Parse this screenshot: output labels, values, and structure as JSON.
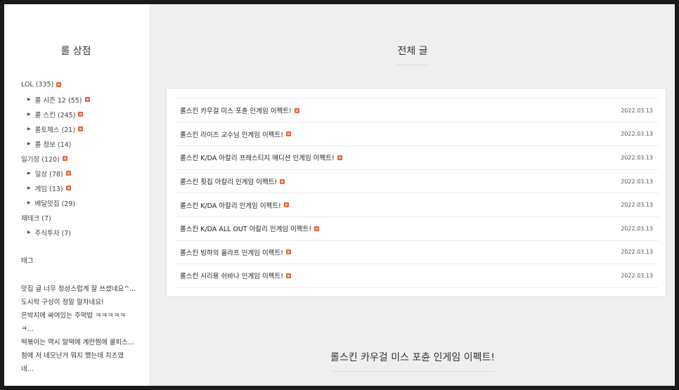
{
  "sidebar": {
    "title": "롤 상점",
    "categories": [
      {
        "label": "LOL (335)",
        "sub": false,
        "new": true
      },
      {
        "label": "롤 시즌 12 (55)",
        "sub": true,
        "new": true
      },
      {
        "label": "롤 스킨 (245)",
        "sub": true,
        "new": true
      },
      {
        "label": "롤토체스 (21)",
        "sub": true,
        "new": true
      },
      {
        "label": "롤 정보 (14)",
        "sub": true,
        "new": false
      },
      {
        "label": "일기장 (120)",
        "sub": false,
        "new": true
      },
      {
        "label": "일상 (78)",
        "sub": true,
        "new": true
      },
      {
        "label": "게임 (13)",
        "sub": true,
        "new": true
      },
      {
        "label": "배달맛집 (29)",
        "sub": true,
        "new": false
      },
      {
        "label": "재테크 (7)",
        "sub": false,
        "new": false
      },
      {
        "label": "주식투자 (7)",
        "sub": true,
        "new": false
      }
    ],
    "tag_title": "태그",
    "comments": [
      [
        "맛집 글 너무 정성스럽게 잘 쓰셨네요^..."
      ],
      [
        "도시락 구성이 정말 알차네요!"
      ],
      [
        "은박지에 싸여있는 주먹밥 ㅋㅋㅋㅋㅋ",
        "ㅋ..."
      ],
      [
        "떡볶이는 역시 말떡에 계란찜에 쿨피스..."
      ],
      [
        "첨에 저 네모난거 뭐지 했는데 치즈였",
        "네..."
      ]
    ]
  },
  "main": {
    "title": "전체 글",
    "posts": [
      {
        "title": "롤스킨 카우걸 미스 포츈 인게임 이펙트!",
        "date": "2022.03.13"
      },
      {
        "title": "롤스킨 라이즈 교수님 인게임 이펙트!",
        "date": "2022.03.13"
      },
      {
        "title": "롤스킨 K/DA 아칼리 프레스티지 에디션 인게임 이펙트!",
        "date": "2022.03.13"
      },
      {
        "title": "롤스킨 횟집 아칼리 인게임 이펙트!",
        "date": "2022.03.13"
      },
      {
        "title": "롤스킨 K/DA 아칼리 인게임 이펙트!",
        "date": "2022.03.13"
      },
      {
        "title": "롤스킨 K/DA ALL OUT 아칼리 인게임 이펙트!",
        "date": "2022.03.13"
      },
      {
        "title": "롤스킨 빙하의 올라프 인게임 이펙트!",
        "date": "2022.03.13"
      },
      {
        "title": "롤스킨 시리용 쉬바나 인게임 이펙트!",
        "date": "2022.03.13"
      }
    ],
    "featured_title": "롤스킨 카우걸 미스 포츈 인게임 이펙트!"
  },
  "colors": {
    "new_badge": "#e8643a",
    "background": "#efefef",
    "panel": "#ffffff"
  },
  "icons": {
    "new": "new-badge-icon",
    "arrow": "triangle-right-icon"
  }
}
